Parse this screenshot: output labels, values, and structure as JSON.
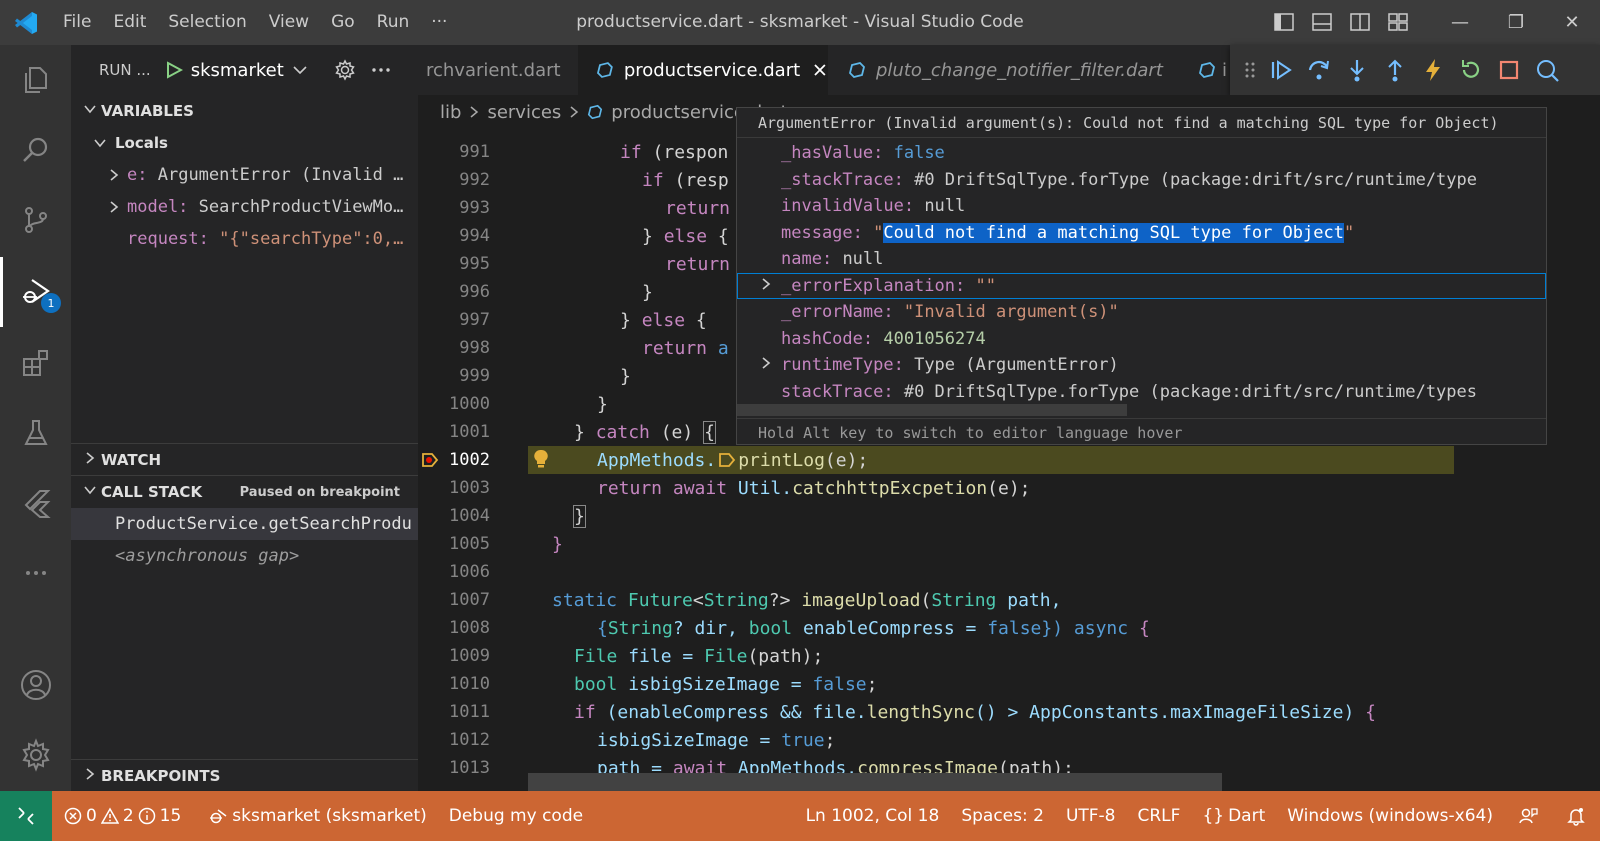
{
  "titlebar": {
    "menu": [
      "File",
      "Edit",
      "Selection",
      "View",
      "Go",
      "Run",
      "···"
    ],
    "title": "productservice.dart - sksmarket - Visual Studio Code",
    "win_minimize": "—",
    "win_restore": "❐",
    "win_close": "✕"
  },
  "activitybar": {
    "debug_badge": "1"
  },
  "sidebar": {
    "run_label": "RUN ...",
    "run_config": "sksmarket",
    "variables_title": "VARIABLES",
    "locals_title": "Locals",
    "locals": [
      {
        "name": "e:",
        "value": "ArgumentError (Invalid …",
        "expandable": true
      },
      {
        "name": "model:",
        "value": "SearchProductViewMo…",
        "expandable": true
      },
      {
        "name": "request:",
        "value": "\"{\"searchType\":0,…",
        "expandable": false
      }
    ],
    "watch_title": "WATCH",
    "callstack_title": "CALL STACK",
    "callstack_status": "Paused on breakpoint",
    "callstack_frames": [
      "ProductService.getSearchProdu",
      "<asynchronous gap>"
    ],
    "breakpoints_title": "BREAKPOINTS"
  },
  "tabs": [
    {
      "label": "rchvarient.dart",
      "active": false
    },
    {
      "label": "productservice.dart",
      "active": true
    },
    {
      "label": "pluto_change_notifier_filter.dart",
      "active": false
    },
    {
      "label": "i",
      "active": false
    }
  ],
  "breadcrumb": [
    "lib",
    "services",
    "productservice.dart"
  ],
  "hover": {
    "title": "ArgumentError (Invalid argument(s): Could not find a matching SQL type for Object)",
    "rows": [
      {
        "name": "_hasValue:",
        "value": "false",
        "kind": "bool",
        "expandable": false
      },
      {
        "name": "_stackTrace:",
        "value": "#0      DriftSqlType.forType (package:drift/src/runtime/type",
        "kind": "plain",
        "expandable": false
      },
      {
        "name": "invalidValue:",
        "value": "null",
        "kind": "plain",
        "expandable": false
      },
      {
        "name": "message:",
        "value_prefix": "\"",
        "value_selected": "Could not find a matching SQL type for Object",
        "value_suffix": "\"",
        "kind": "string-selected",
        "expandable": false
      },
      {
        "name": "name:",
        "value": "null",
        "kind": "plain",
        "expandable": false
      },
      {
        "name": "_errorExplanation:",
        "value": "\"\"",
        "kind": "string",
        "expandable": true,
        "focused": true
      },
      {
        "name": "_errorName:",
        "value": "\"Invalid argument(s)\"",
        "kind": "string",
        "expandable": false
      },
      {
        "name": "hashCode:",
        "value": "4001056274",
        "kind": "number",
        "expandable": false
      },
      {
        "name": "runtimeType:",
        "value": "Type (ArgumentError)",
        "kind": "plain",
        "expandable": true
      },
      {
        "name": "stackTrace:",
        "value": "#0      DriftSqlType.forType (package:drift/src/runtime/types",
        "kind": "plain",
        "expandable": false
      }
    ],
    "status": "Hold Alt key to switch to editor language hover"
  },
  "editor": {
    "current_line": "1002",
    "lines": [
      {
        "n": "991"
      },
      {
        "n": "992"
      },
      {
        "n": "993"
      },
      {
        "n": "994"
      },
      {
        "n": "995"
      },
      {
        "n": "996"
      },
      {
        "n": "997"
      },
      {
        "n": "998"
      },
      {
        "n": "999"
      },
      {
        "n": "1000"
      },
      {
        "n": "1001"
      },
      {
        "n": "1002"
      },
      {
        "n": "1003"
      },
      {
        "n": "1004"
      },
      {
        "n": "1005"
      },
      {
        "n": "1006"
      },
      {
        "n": "1007"
      },
      {
        "n": "1008"
      },
      {
        "n": "1009"
      },
      {
        "n": "1010"
      },
      {
        "n": "1011"
      },
      {
        "n": "1012"
      },
      {
        "n": "1013"
      }
    ],
    "code": {
      "l991_a": "if",
      "l991_b": "(respon",
      "l992_a": "if",
      "l992_b": "(resp",
      "l993": "return",
      "l994_a": "}",
      "l994_b": "else",
      "l994_c": "{",
      "l995": "return",
      "l996": "}",
      "l997_a": "}",
      "l997_b": "else",
      "l997_c": "{",
      "l998_a": "return",
      "l998_b": "a",
      "l999": "}",
      "l1000": "}",
      "l1001_a": "}",
      "l1001_b": "catch",
      "l1001_c": "(e)",
      "l1001_d": "{",
      "l1002_a": "AppMethods.",
      "l1002_b": "printLog",
      "l1002_c": "(e);",
      "l1003_a": "return",
      "l1003_b": "await",
      "l1003_c": "Util.",
      "l1003_d": "catchhttpExcpetion",
      "l1003_e": "(e);",
      "l1004": "}",
      "l1005": "}",
      "l1007_a": "static",
      "l1007_b": "Future",
      "l1007_c": "<",
      "l1007_d": "String",
      "l1007_e": "?>",
      "l1007_f": "imageUpload",
      "l1007_g": "(",
      "l1007_h": "String",
      "l1007_i": "path,",
      "l1008_a": "{",
      "l1008_b": "String",
      "l1008_c": "? dir,",
      "l1008_d": "bool",
      "l1008_e": "enableCompress =",
      "l1008_f": "false",
      "l1008_g": "})",
      "l1008_h": "async",
      "l1008_i": "{",
      "l1009_a": "File",
      "l1009_b": "file =",
      "l1009_c": "File",
      "l1009_d": "(path);",
      "l1010_a": "bool",
      "l1010_b": "isbigSizeImage =",
      "l1010_c": "false",
      "l1010_d": ";",
      "l1011_a": "if",
      "l1011_b": "(enableCompress && file.",
      "l1011_c": "lengthSync",
      "l1011_d": "() > AppConstants.maxImageFileSize)",
      "l1011_e": "{",
      "l1012_a": "isbigSizeImage =",
      "l1012_b": "true",
      "l1012_c": ";",
      "l1013_a": "path =",
      "l1013_b": "await",
      "l1013_c": "AppMethods.",
      "l1013_d": "compressImage",
      "l1013_e": "(path);"
    }
  },
  "statusbar": {
    "errors": "0",
    "warnings": "2",
    "infos": "15",
    "debug_target": "sksmarket (sksmarket)",
    "debug_mode": "Debug my code",
    "position": "Ln 1002, Col 18",
    "spaces": "Spaces: 2",
    "encoding": "UTF-8",
    "eol": "CRLF",
    "language": "Dart",
    "platform": "Windows (windows-x64)"
  },
  "colors": {
    "statusbar_debug": "#cc6633",
    "remote": "#16825d",
    "accent": "#007acc",
    "current_line_bg": "#4b4a1f",
    "selection": "#0e63c7"
  }
}
